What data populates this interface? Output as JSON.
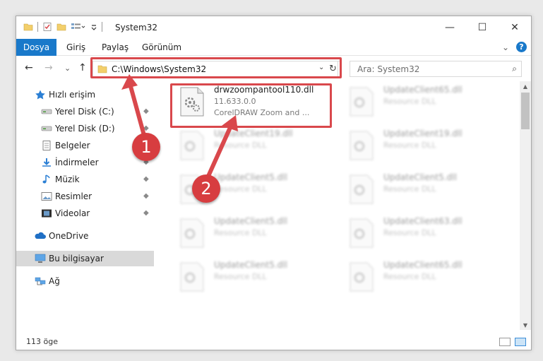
{
  "window": {
    "title": "System32",
    "controls": {
      "minimize": "—",
      "maximize": "☐",
      "close": "✕"
    }
  },
  "ribbon": {
    "tabs": [
      "Dosya",
      "Giriş",
      "Paylaş",
      "Görünüm"
    ],
    "expand_glyph": "⌄",
    "help_glyph": "?"
  },
  "nav": {
    "back_glyph": "←",
    "forward_glyph": "→",
    "recent_glyph": "⌄",
    "up_glyph": "↑",
    "address": "C:\\Windows\\System32",
    "address_drop_glyph": "⌄",
    "refresh_glyph": "↻",
    "search_placeholder": "Ara: System32",
    "search_glyph": "⌕"
  },
  "sidebar": {
    "items": [
      {
        "label": "Hızlı erişim",
        "icon": "star-icon",
        "pinned": false
      },
      {
        "label": "Yerel Disk (C:)",
        "icon": "drive-icon",
        "pinned": true
      },
      {
        "label": "Yerel Disk (D:)",
        "icon": "drive-icon",
        "pinned": true
      },
      {
        "label": "Belgeler",
        "icon": "documents-icon",
        "pinned": true
      },
      {
        "label": "İndirmeler",
        "icon": "downloads-icon",
        "pinned": true
      },
      {
        "label": "Müzik",
        "icon": "music-icon",
        "pinned": true
      },
      {
        "label": "Resimler",
        "icon": "pictures-icon",
        "pinned": true
      },
      {
        "label": "Videolar",
        "icon": "videos-icon",
        "pinned": true
      },
      {
        "label": "OneDrive",
        "icon": "onedrive-icon",
        "pinned": false
      },
      {
        "label": "Bu bilgisayar",
        "icon": "computer-icon",
        "pinned": false,
        "selected": true
      },
      {
        "label": "Ağ",
        "icon": "network-icon",
        "pinned": false
      }
    ],
    "pin_glyph": "📌"
  },
  "files": {
    "highlighted": {
      "name": "drwzoompantool110.dll",
      "version": "11.633.0.0",
      "description": "CorelDRAW Zoom and ..."
    },
    "left_column": [
      {
        "name": "UpdateClient19.dll",
        "type": "Resource DLL"
      },
      {
        "name": "UpdateClient5.dll",
        "type": "Resource DLL"
      },
      {
        "name": "UpdateClient5.dll",
        "type": "Resource DLL"
      },
      {
        "name": "UpdateClient5.dll",
        "type": "Resource DLL"
      }
    ],
    "right_column": [
      {
        "name": "UpdateClient65.dll",
        "type": "Resource DLL"
      },
      {
        "name": "UpdateClient19.dll",
        "type": "Resource DLL"
      },
      {
        "name": "UpdateClient5.dll",
        "type": "Resource DLL"
      },
      {
        "name": "UpdateClient63.dll",
        "type": "Resource DLL"
      },
      {
        "name": "UpdateClient65.dll",
        "type": "Resource DLL"
      }
    ]
  },
  "status": {
    "count": "113 öge"
  },
  "callouts": [
    "1",
    "2"
  ],
  "colors": {
    "accent": "#1979ca",
    "highlight_red": "#d9484c",
    "callout_red": "#d73d40"
  }
}
